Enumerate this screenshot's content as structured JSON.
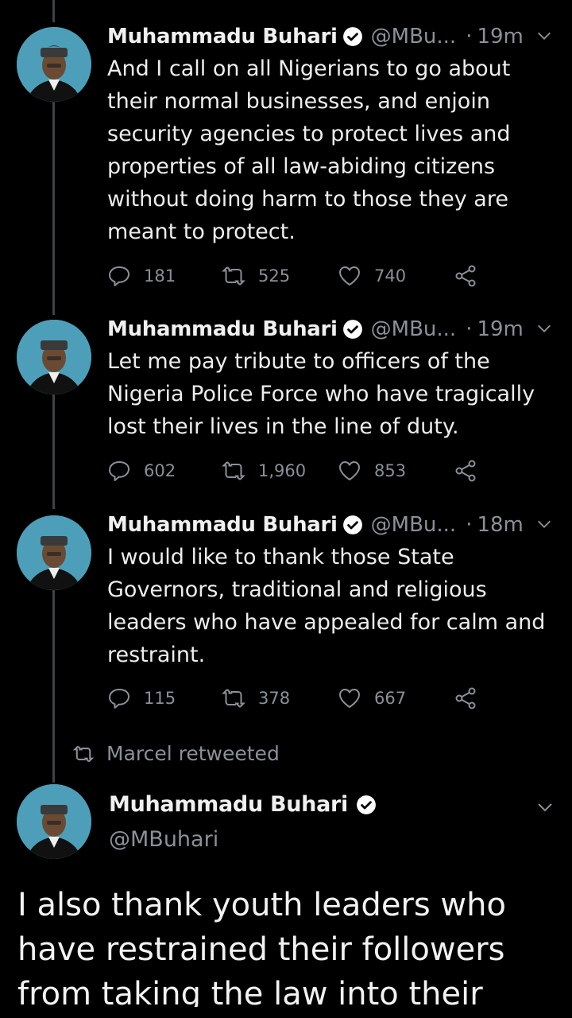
{
  "tweets": [
    {
      "name": "Muhammadu Buhari",
      "handle": "@MBu...",
      "time": "19m",
      "text": "And I call on all Nigerians to go about their normal businesses, and enjoin security agencies to protect lives and properties of all law-abiding citizens without doing harm to those they are meant to protect.",
      "replies": "181",
      "retweets": "525",
      "likes": "740"
    },
    {
      "name": "Muhammadu Buhari",
      "handle": "@MBu...",
      "time": "19m",
      "text": "Let me pay tribute to officers of the Nigeria Police Force who have tragically lost their lives in the line of duty.",
      "replies": "602",
      "retweets": "1,960",
      "likes": "853"
    },
    {
      "name": "Muhammadu Buhari",
      "handle": "@MBu...",
      "time": "18m",
      "text": "I would like to thank those State Governors, traditional and religious leaders who have appealed for calm and restraint.",
      "replies": "115",
      "retweets": "378",
      "likes": "667"
    }
  ],
  "retweeted_by": "Marcel retweeted",
  "main_tweet": {
    "name": "Muhammadu Buhari",
    "handle": "@MBuhari",
    "text": "I also thank youth leaders who have restrained their followers from taking the law into their"
  },
  "icons": [
    "reply-icon",
    "retweet-icon",
    "like-icon",
    "share-icon",
    "verified-icon",
    "chevron-down-icon"
  ],
  "colors": {
    "background": "#000000",
    "secondary_text": "#8a9099",
    "verified_bg": "#ffffff",
    "avatar_bg": "#4d9fb9"
  }
}
